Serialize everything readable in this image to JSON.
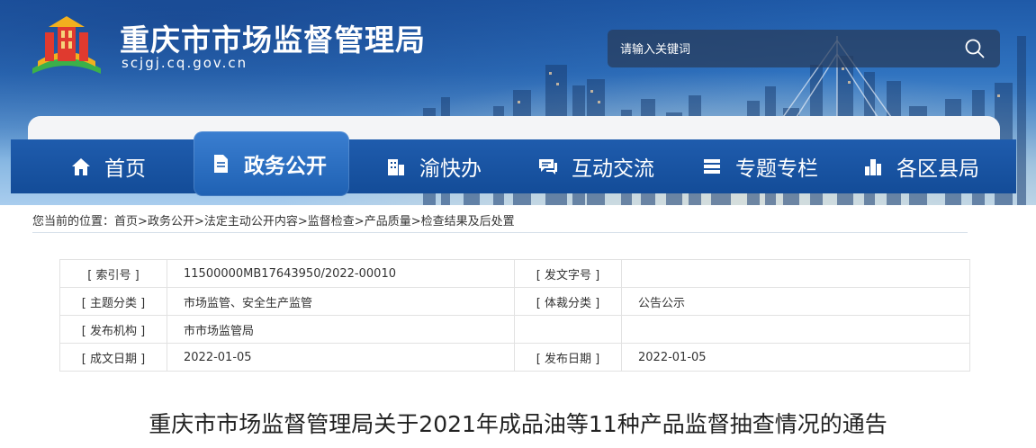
{
  "header": {
    "title": "重庆市市场监督管理局",
    "domain": "scjgj.cq.gov.cn",
    "search_placeholder": "请输入关键词"
  },
  "nav": {
    "items": [
      {
        "label": "首页",
        "icon": "home-icon"
      },
      {
        "label": "政务公开",
        "icon": "document-icon",
        "active": true
      },
      {
        "label": "渝快办",
        "icon": "building-icon"
      },
      {
        "label": "互动交流",
        "icon": "chat-icon"
      },
      {
        "label": "专题专栏",
        "icon": "stack-icon"
      },
      {
        "label": "各区县局",
        "icon": "city-icon"
      }
    ]
  },
  "breadcrumb": {
    "prefix": "您当前的位置：",
    "items": [
      "首页",
      "政务公开",
      "法定主动公开内容",
      "监督检查",
      "产品质量",
      "检查结果及后处置"
    ],
    "separator": ">"
  },
  "meta": {
    "rows": [
      {
        "l1": "[ 索引号 ]",
        "v1": "11500000MB17643950/2022-00010",
        "l2": "[ 发文字号 ]",
        "v2": ""
      },
      {
        "l1": "[ 主题分类 ]",
        "v1": "市场监管、安全生产监管",
        "l2": "[ 体裁分类 ]",
        "v2": "公告公示"
      },
      {
        "l1": "[ 发布机构 ]",
        "v1": "市市场监管局",
        "l2": "",
        "v2": ""
      },
      {
        "l1": "[ 成文日期 ]",
        "v1": "2022-01-05",
        "l2": "[ 发布日期 ]",
        "v2": "2022-01-05"
      }
    ]
  },
  "article": {
    "title": "重庆市市场监督管理局关于2021年成品油等11种产品监督抽查情况的通告"
  },
  "colors": {
    "nav_bg": "#134c98",
    "nav_active": "#2f72c4",
    "logo_red": "#e03a2f",
    "logo_yellow": "#f2b01e",
    "logo_green": "#3bb04a"
  }
}
